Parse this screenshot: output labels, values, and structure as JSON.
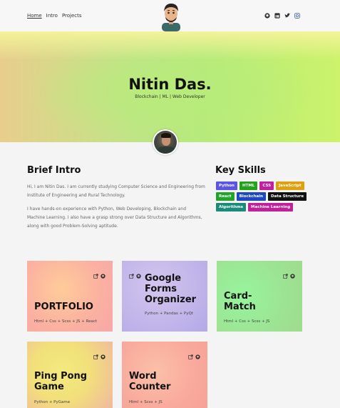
{
  "nav": {
    "links": [
      "Home",
      "Intro",
      "Projects"
    ],
    "icons": [
      "github-icon",
      "linkedin-icon",
      "twitter-icon",
      "instagram-icon"
    ]
  },
  "hero": {
    "name": "Nitin Das.",
    "subtitle": "Blockchain | ML | Web Developer"
  },
  "intro": {
    "title": "Brief Intro",
    "paragraphs": [
      "Hi, I am Nitin Das. I am currently studying Computer Science and Engineering from Institute of Engineering and Rural Technology.",
      "I have hands-on experience with Python, Web Developing, Blockchain and Machine Learning. I also have a grasp strong over Data Structure and Algorithms, along with good Problem-Solving aptitude."
    ]
  },
  "skills": {
    "title": "Key Skills",
    "tags": [
      {
        "label": "Python",
        "color": "#5a55e8"
      },
      {
        "label": "HTML",
        "color": "#23a31c"
      },
      {
        "label": "CSS",
        "color": "#c3209f"
      },
      {
        "label": "JavaScript",
        "color": "#e0a10e"
      },
      {
        "label": "React",
        "color": "#20a52a"
      },
      {
        "label": "Blockchain",
        "color": "#1c48c8"
      },
      {
        "label": "Data Structure",
        "color": "#111111"
      },
      {
        "label": "Algorithms",
        "color": "#1a8a7a"
      },
      {
        "label": "Machine Learning",
        "color": "#c0209a"
      }
    ]
  },
  "projects": [
    {
      "title": "PORTFOLIO",
      "tech": "Html + Css + Scss + JS + React"
    },
    {
      "title": "Google Forms Organizer",
      "tech": "Python + Pandas + PyQt"
    },
    {
      "title": "Card-Match",
      "tech": "Html + Css + Scss + JS"
    },
    {
      "title": "Ping Pong Game",
      "tech": "Python + PyGame"
    },
    {
      "title": "Word Counter",
      "tech": "Html + Scss + JS"
    }
  ]
}
